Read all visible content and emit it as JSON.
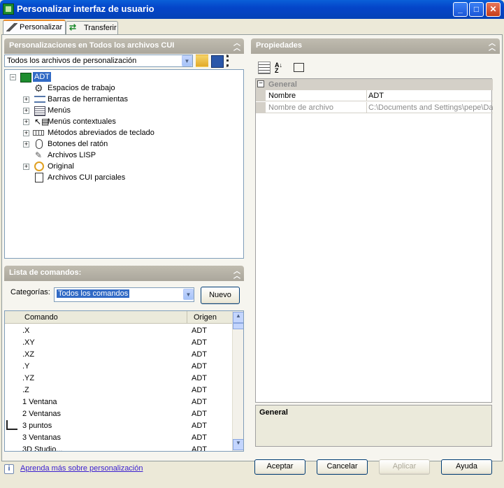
{
  "window": {
    "title": "Personalizar interfaz de usuario"
  },
  "tabs": [
    {
      "label": "Personalizar"
    },
    {
      "label": "Transferir"
    }
  ],
  "customizations": {
    "header": "Personalizaciones en Todos los archivos CUI",
    "filter_value": "Todos los archivos de personalización",
    "tree": [
      {
        "label": "ADT",
        "icon": "workspace-app-icon"
      },
      {
        "label": "Espacios de trabajo",
        "icon": "gear-icon"
      },
      {
        "label": "Barras de herramientas",
        "icon": "toolbar-icon"
      },
      {
        "label": "Menús",
        "icon": "menu-icon"
      },
      {
        "label": "Menús contextuales",
        "icon": "context-menu-icon"
      },
      {
        "label": "Métodos abreviados de teclado",
        "icon": "keyboard-icon"
      },
      {
        "label": "Botones del ratón",
        "icon": "mouse-icon"
      },
      {
        "label": "Archivos LISP",
        "icon": "lisp-icon"
      },
      {
        "label": "Original",
        "icon": "original-icon"
      },
      {
        "label": "Archivos CUI parciales",
        "icon": "partial-cui-icon"
      }
    ]
  },
  "commands": {
    "header": "Lista de comandos:",
    "categories_label": "Categorías:",
    "category_value": "Todos los comandos",
    "new_button": "Nuevo",
    "columns": {
      "command": "Comando",
      "origin": "Origen"
    },
    "rows": [
      {
        "command": ".X",
        "origin": "ADT"
      },
      {
        "command": ".XY",
        "origin": "ADT"
      },
      {
        "command": ".XZ",
        "origin": "ADT"
      },
      {
        "command": ".Y",
        "origin": "ADT"
      },
      {
        "command": ".YZ",
        "origin": "ADT"
      },
      {
        "command": ".Z",
        "origin": "ADT"
      },
      {
        "command": "1 Ventana",
        "origin": "ADT"
      },
      {
        "command": "2 Ventanas",
        "origin": "ADT"
      },
      {
        "command": "3 puntos",
        "origin": "ADT"
      },
      {
        "command": "3 Ventanas",
        "origin": "ADT"
      },
      {
        "command": "3D Studio...",
        "origin": "ADT"
      }
    ]
  },
  "properties": {
    "header": "Propiedades",
    "group": "General",
    "rows": [
      {
        "name": "Nombre",
        "value": "ADT"
      },
      {
        "name": "Nombre de archivo",
        "value": "C:\\Documents and Settings\\pepe\\Da"
      }
    ],
    "description_title": "General"
  },
  "footer": {
    "help_link": "Aprenda más sobre personalización",
    "accept": "Aceptar",
    "cancel": "Cancelar",
    "apply": "Aplicar",
    "help": "Ayuda"
  },
  "colors": {
    "titlebar": "#0445c9",
    "panel_header": "#aba79c",
    "selection": "#316ac5"
  }
}
